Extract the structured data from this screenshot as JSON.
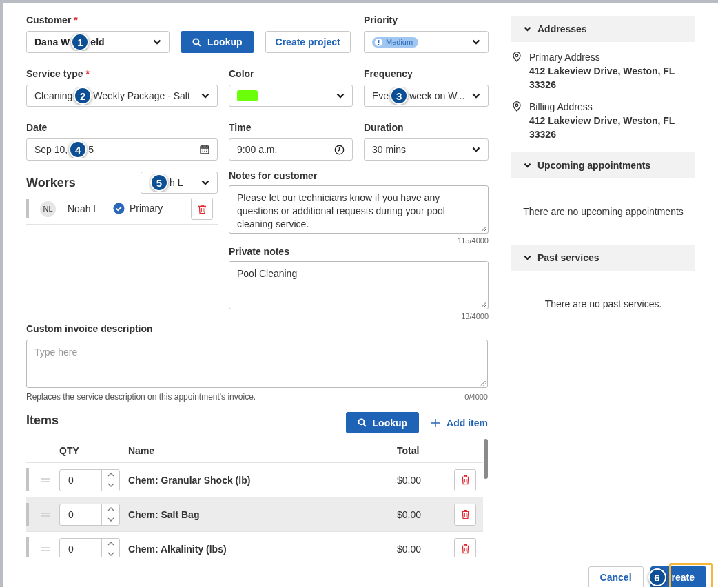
{
  "form": {
    "customer": {
      "label": "Customer",
      "required_mark": "*",
      "value_before": "Dana W",
      "callout": "1",
      "value_after": "eld"
    },
    "lookup_button": "Lookup",
    "create_project_button": "Create project",
    "priority": {
      "label": "Priority",
      "value": "Medium"
    },
    "fields": [
      {
        "label": "Service type",
        "required_mark": "*",
        "kind": "select",
        "value_before": "Cleaning",
        "callout": "2",
        "value_after": "Weekly Package - Salt"
      },
      {
        "label": "Color",
        "kind": "color",
        "color": "#6cff0a"
      },
      {
        "label": "Frequency",
        "kind": "select",
        "value_before": "Eve",
        "callout": "3",
        "value_after": "week on W..."
      },
      {
        "label": "Date",
        "kind": "date",
        "value_before": "Sep 10,",
        "callout": "4",
        "value_after": "5"
      },
      {
        "label": "Time",
        "kind": "time",
        "value": "9:00 a.m."
      },
      {
        "label": "Duration",
        "kind": "select",
        "value": "30 mins"
      }
    ]
  },
  "workers": {
    "title": "Workers",
    "select": {
      "callout": "5",
      "value_after": "h L"
    },
    "list": [
      {
        "initials": "NL",
        "name": "Noah L",
        "primary": true,
        "primary_label": "Primary"
      }
    ]
  },
  "notes": [
    {
      "label": "Notes for customer",
      "value": "Please let our technicians know if you have any questions or additional requests during your pool cleaning service.",
      "counter": "115/4000"
    },
    {
      "label": "Private notes",
      "value": "Pool Cleaning",
      "counter": "13/4000"
    }
  ],
  "invoice_description": {
    "label": "Custom invoice description",
    "placeholder": "Type here",
    "hint": "Replaces the service description on this appointment's invoice.",
    "counter": "0/4000"
  },
  "items": {
    "title": "Items",
    "lookup_button": "Lookup",
    "add_button": "Add item",
    "columns": [
      "QTY",
      "Name",
      "Total"
    ],
    "rows": [
      {
        "qty": "0",
        "name": "Chem: Granular Shock (lb)",
        "total": "$0.00",
        "hovered": false
      },
      {
        "qty": "0",
        "name": "Chem: Salt Bag",
        "total": "$0.00",
        "hovered": true
      },
      {
        "qty": "0",
        "name": "Chem: Alkalinity (lbs)",
        "total": "$0.00",
        "hovered": false
      }
    ]
  },
  "sidebar": {
    "sections": [
      {
        "title": "Addresses",
        "expanded": true,
        "kind": "addresses",
        "addresses": [
          {
            "label": "Primary Address",
            "value": "412 Lakeview Drive, Weston, FL 33326"
          },
          {
            "label": "Billing Address",
            "value": "412 Lakeview Drive, Weston, FL 33326"
          }
        ]
      },
      {
        "title": "Upcoming appointments",
        "expanded": true,
        "kind": "empty",
        "empty_text": "There are no upcoming appointments"
      },
      {
        "title": "Past services",
        "expanded": true,
        "kind": "empty",
        "empty_text": "There are no past services."
      }
    ]
  },
  "footer": {
    "cancel_button": "Cancel",
    "create_button": {
      "callout": "6",
      "text_after": "reate",
      "highlighted": true
    }
  }
}
